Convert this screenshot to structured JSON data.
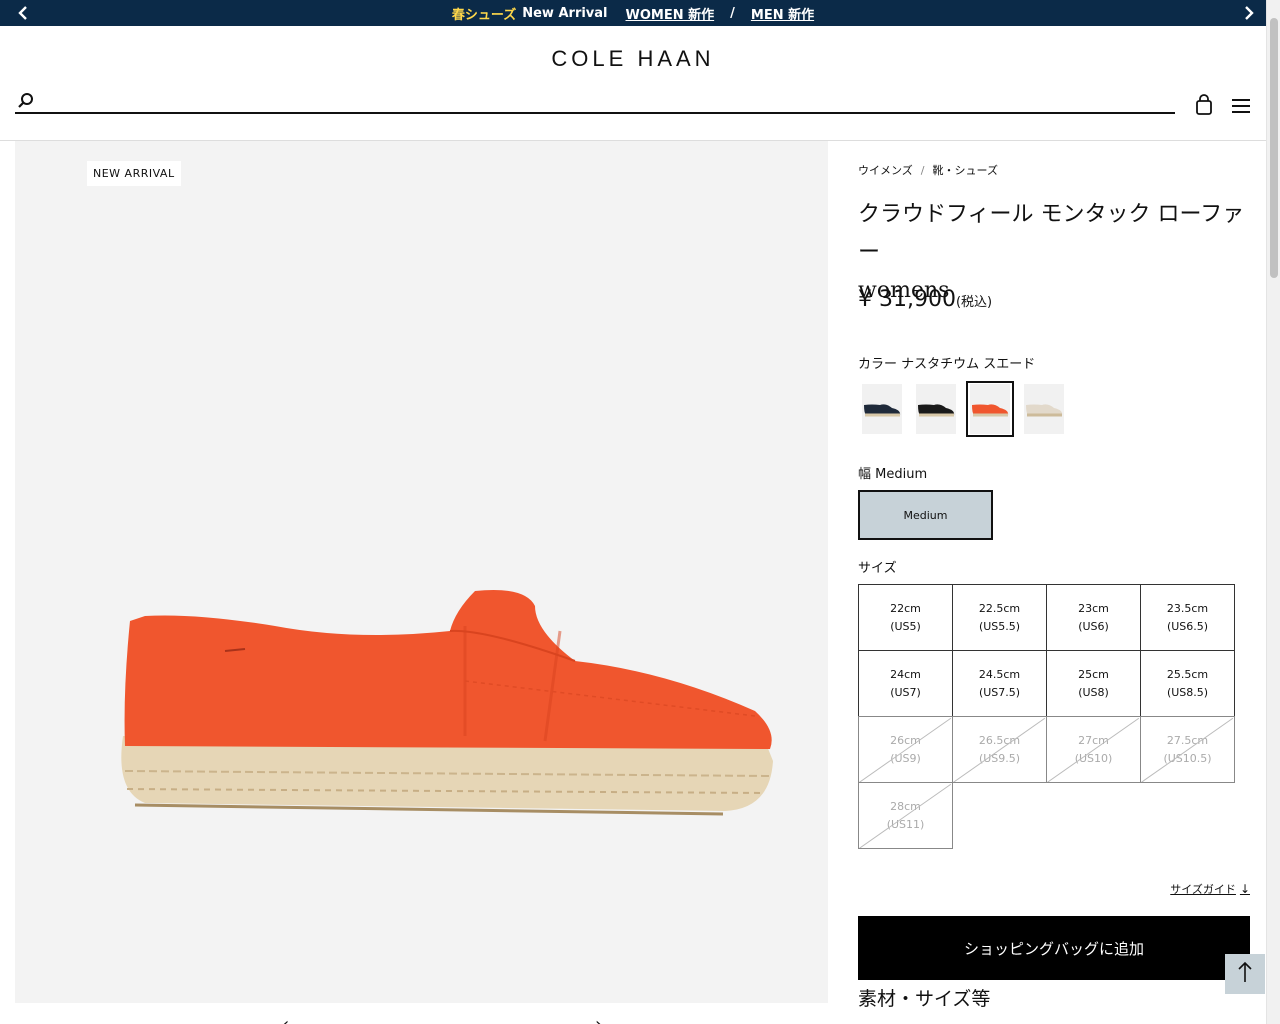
{
  "announcement": {
    "highlight": "春シューズ",
    "text": "New Arrival",
    "women_link": "WOMEN 新作",
    "separator": "/",
    "men_link": "MEN 新作"
  },
  "header": {
    "logo": "COLE HAAN",
    "search_placeholder": ""
  },
  "gallery": {
    "badge": "NEW ARRIVAL",
    "prev": "‹",
    "next": "›"
  },
  "breadcrumb": {
    "items": [
      "ウイメンズ",
      "靴・シューズ"
    ],
    "separator": "/"
  },
  "product": {
    "title": "クラウドフィール モンタック ローファー",
    "subtitle": "womens",
    "price": "¥ 31,900",
    "tax": "(税込)",
    "color_label": "カラー ナスタチウム スエード",
    "swatches": [
      {
        "name": "navy",
        "color": "#1f2a3a",
        "selected": false
      },
      {
        "name": "black",
        "color": "#1a1a1a",
        "selected": false
      },
      {
        "name": "nasturtium",
        "color": "#f0562e",
        "selected": true
      },
      {
        "name": "sand",
        "color": "#e2d9cb",
        "selected": false
      }
    ],
    "width_label": "幅 Medium",
    "width_option": "Medium",
    "size_label": "サイズ",
    "sizes": [
      {
        "cm": "22cm",
        "us": "(US5)",
        "available": true
      },
      {
        "cm": "22.5cm",
        "us": "(US5.5)",
        "available": true
      },
      {
        "cm": "23cm",
        "us": "(US6)",
        "available": true
      },
      {
        "cm": "23.5cm",
        "us": "(US6.5)",
        "available": true
      },
      {
        "cm": "24cm",
        "us": "(US7)",
        "available": true
      },
      {
        "cm": "24.5cm",
        "us": "(US7.5)",
        "available": true
      },
      {
        "cm": "25cm",
        "us": "(US8)",
        "available": true
      },
      {
        "cm": "25.5cm",
        "us": "(US8.5)",
        "available": true
      },
      {
        "cm": "26cm",
        "us": "(US9)",
        "available": false
      },
      {
        "cm": "26.5cm",
        "us": "(US9.5)",
        "available": false
      },
      {
        "cm": "27cm",
        "us": "(US10)",
        "available": false
      },
      {
        "cm": "27.5cm",
        "us": "(US10.5)",
        "available": false
      },
      {
        "cm": "28cm",
        "us": "(US11)",
        "available": false
      }
    ],
    "size_guide": "サイズガイド",
    "add_to_bag": "ショッピングバッグに追加",
    "details_heading": "素材・サイズ等"
  },
  "colors": {
    "announce_bg": "#0b2a48",
    "highlight": "#ffd84a",
    "selected_width": "#c7d2d8",
    "shoe": "#f0562e"
  }
}
